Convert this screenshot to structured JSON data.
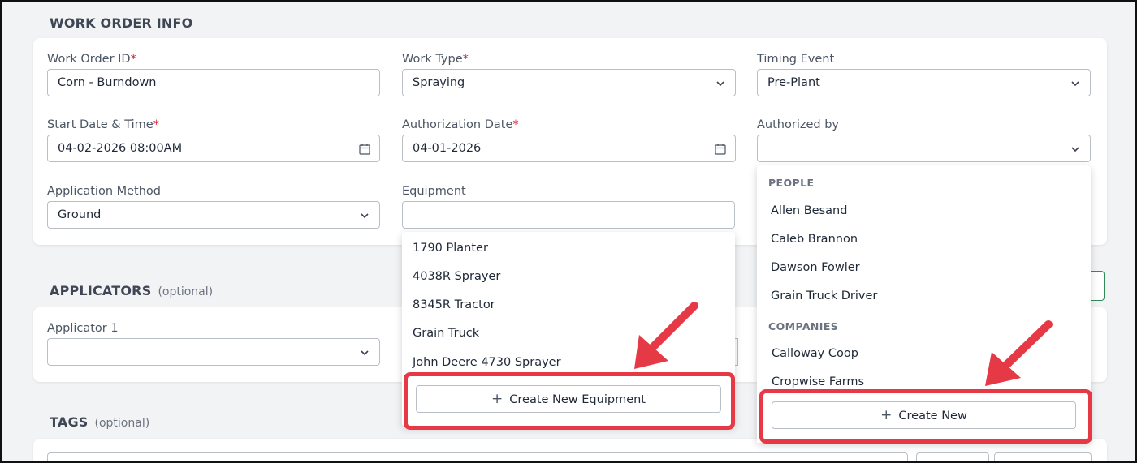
{
  "sections": {
    "work_order_info": "WORK ORDER INFO",
    "applicators": "APPLICATORS",
    "applicators_optional": "(optional)",
    "tags": "TAGS",
    "tags_optional": "(optional)"
  },
  "fields": {
    "work_order_id": {
      "label": "Work Order ID",
      "required": "*",
      "value": "Corn - Burndown"
    },
    "work_type": {
      "label": "Work Type",
      "required": "*",
      "value": "Spraying"
    },
    "timing_event": {
      "label": "Timing Event",
      "value": "Pre-Plant"
    },
    "start_date": {
      "label": "Start Date & Time",
      "required": "*",
      "value": "04-02-2026 08:00AM"
    },
    "authorization_date": {
      "label": "Authorization Date",
      "required": "*",
      "value": "04-01-2026"
    },
    "authorized_by": {
      "label": "Authorized by",
      "value": ""
    },
    "application_method": {
      "label": "Application Method",
      "value": "Ground"
    },
    "equipment": {
      "label": "Equipment",
      "value": ""
    },
    "applicator_1": {
      "label": "Applicator 1",
      "value": ""
    }
  },
  "equipment_dropdown": {
    "items": [
      "1790 Planter",
      "4038R Sprayer",
      "8345R Tractor",
      "Grain Truck",
      "John Deere 4730 Sprayer"
    ],
    "create_label": "Create New Equipment"
  },
  "authorized_dropdown": {
    "people_header": "PEOPLE",
    "people": [
      "Allen Besand",
      "Caleb Brannon",
      "Dawson Fowler",
      "Grain Truck Driver"
    ],
    "companies_header": "COMPANIES",
    "companies": [
      "Calloway Coop",
      "Cropwise Farms"
    ],
    "create_label": "Create New"
  },
  "icons": {
    "chevron": "chevron-down-icon",
    "calendar": "calendar-icon",
    "plus": "+"
  },
  "colors": {
    "required": "#d11f2f",
    "highlight": "#e63946",
    "background": "#f2f3f5"
  }
}
